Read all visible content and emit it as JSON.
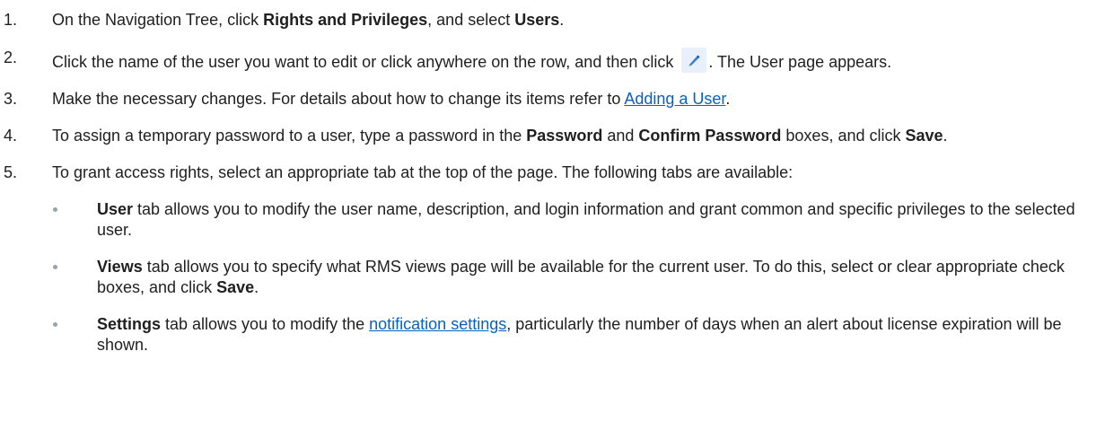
{
  "steps": [
    {
      "num": "1.",
      "t1": "On the Navigation Tree, click ",
      "b1": "Rights and Privileges",
      "t2": ", and select ",
      "b2": "Users",
      "t3": "."
    },
    {
      "num": "2.",
      "t1": "Click the name of the user you want to edit or click anywhere on the row, and then click ",
      "icon": "pencil-edit-icon",
      "t2": ". The User page appears."
    },
    {
      "num": "3.",
      "t1": "Make the necessary changes. For details about how to change its items refer to ",
      "link": "Adding a User",
      "t2": "."
    },
    {
      "num": "4.",
      "t1": "To assign a temporary password to a user, type a password in the ",
      "b1": "Password",
      "t2": " and ",
      "b2": "Confirm Password",
      "t3": " boxes, and click ",
      "b3": "Save",
      "t4": "."
    },
    {
      "num": "5.",
      "t1": "To grant access rights, select an appropriate tab at the top of the page. The following tabs are available:"
    }
  ],
  "bullets": [
    {
      "b1": "User",
      "t1": " tab allows you to modify the user name, description, and login information and grant common and specific privileges to the selected user."
    },
    {
      "b1": "Views",
      "t1": " tab allows you to specify what RMS views page will be available for the current user. To do this, select or clear appropriate check boxes, and click ",
      "b2": "Save",
      "t2": "."
    },
    {
      "b1": "Settings",
      "t1": " tab allows you to modify the ",
      "link": "notification settings",
      "t2": ", particularly the number of days when an alert about license expiration will be shown."
    }
  ],
  "colors": {
    "text": "#1f1f1f",
    "link": "#0563c1",
    "bullet": "#9aa4a8",
    "icon_bg": "#e8f0f9"
  }
}
